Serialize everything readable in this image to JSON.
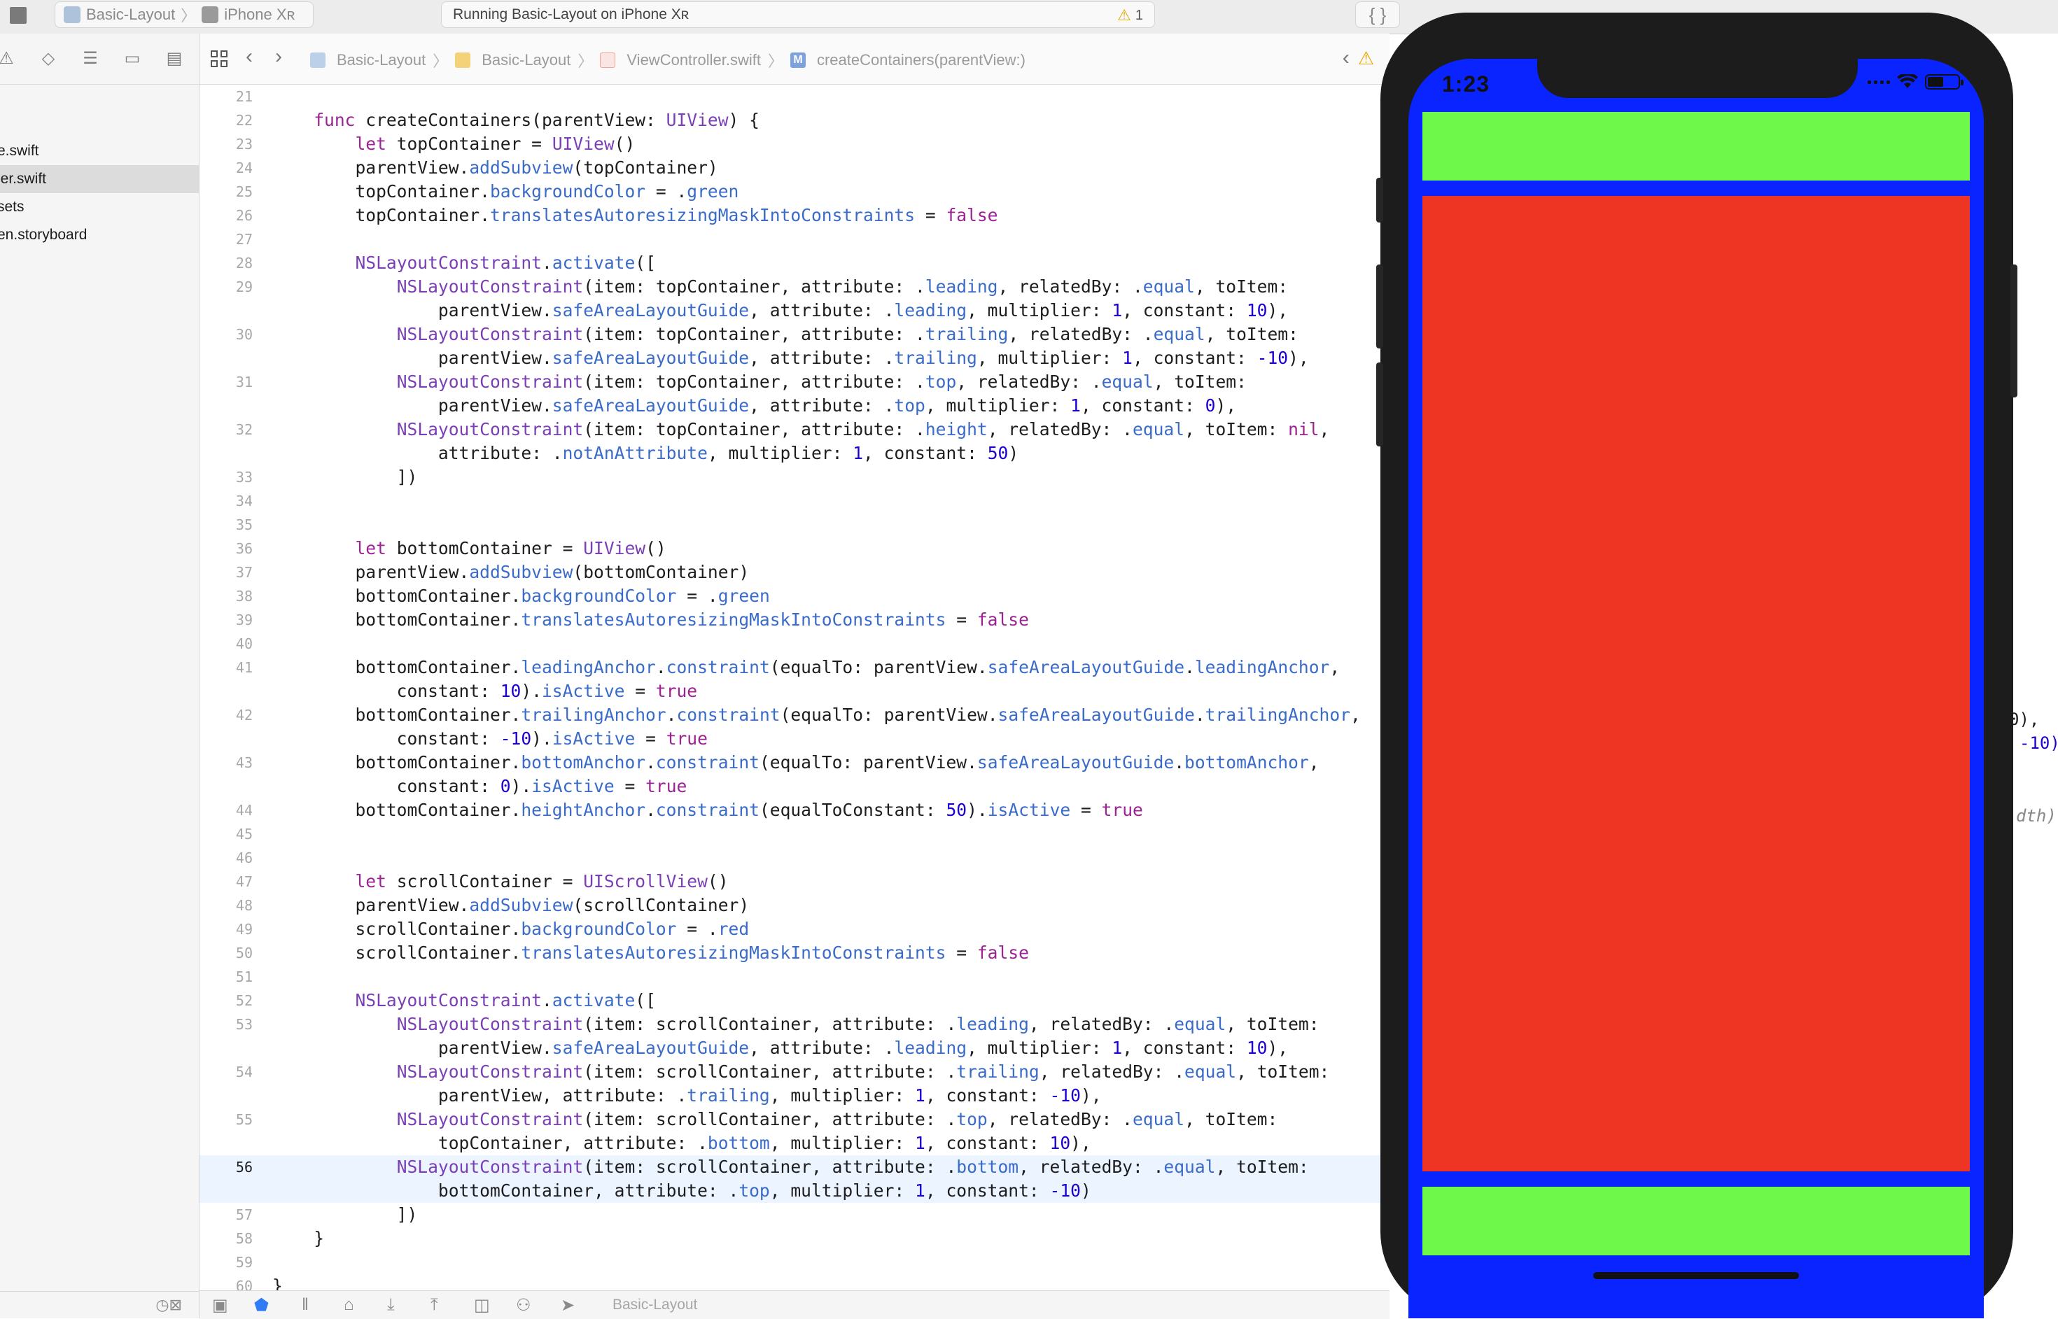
{
  "titlebar": {
    "scheme_project": "Basic-Layout",
    "scheme_device": "iPhone Xʀ",
    "status_text": "Running Basic-Layout on iPhone Xʀ",
    "warning_count": "1",
    "library_symbol": "{ }"
  },
  "navigator": {
    "items": [
      {
        "label": "e.swift",
        "selected": false
      },
      {
        "label": "ler.swift",
        "selected": true
      },
      {
        "label": "sets",
        "selected": false
      },
      {
        "label": "en.storyboard",
        "selected": false
      }
    ]
  },
  "jumpbar": {
    "crumbs": [
      "Basic-Layout",
      "Basic-Layout",
      "ViewController.swift",
      "createContainers(parentView:)"
    ]
  },
  "editor": {
    "current_line": "56",
    "line_numbers": [
      "21",
      "22",
      "23",
      "24",
      "25",
      "26",
      "27",
      "28",
      "29",
      "",
      "30",
      "",
      "31",
      "",
      "32",
      "",
      "33",
      "34",
      "35",
      "36",
      "37",
      "38",
      "39",
      "40",
      "41",
      "",
      "42",
      "",
      "43",
      "",
      "44",
      "45",
      "46",
      "47",
      "48",
      "49",
      "50",
      "51",
      "52",
      "53",
      "",
      "54",
      "",
      "55",
      "",
      "56",
      "",
      "57",
      "58",
      "59",
      "60"
    ]
  },
  "right_pane": {
    "fragments": [
      "0),",
      "-10)",
      "dth),"
    ]
  },
  "debugbar": {
    "target": "Basic-Layout"
  },
  "simulator": {
    "time": "1:23",
    "colors": {
      "background": "#0a24ff",
      "top_container": "#6ef94a",
      "scroll_container": "#ee3423",
      "bottom_container": "#6ef94a"
    }
  }
}
